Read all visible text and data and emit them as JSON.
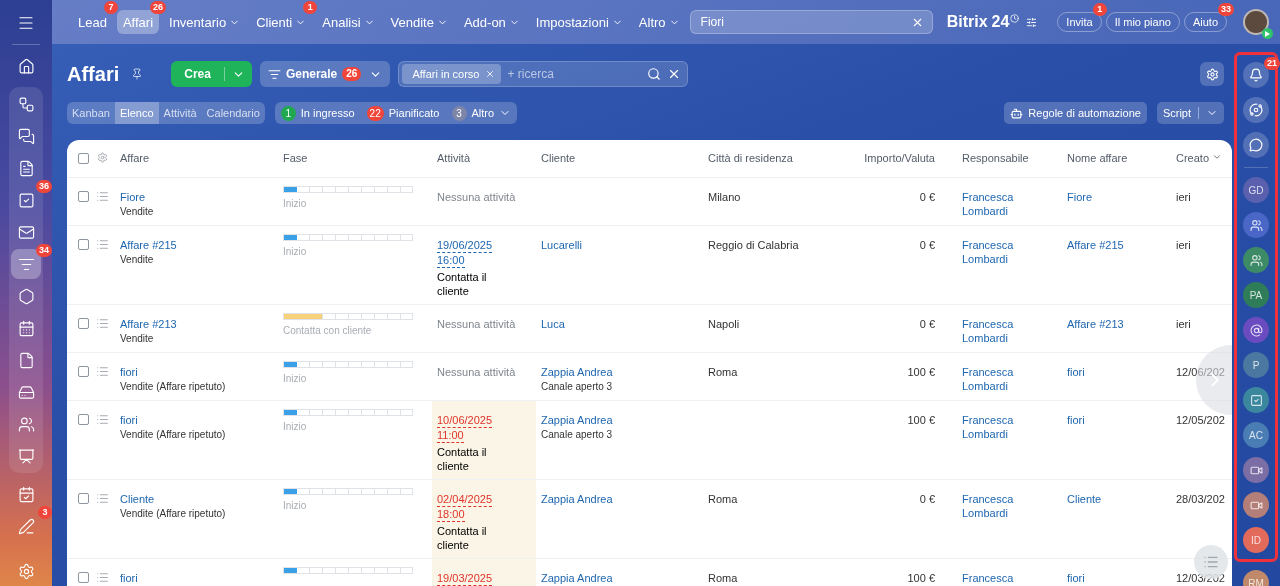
{
  "top_nav": {
    "items": [
      {
        "label": "Lead",
        "badge": "7",
        "dropdown": false,
        "selected": false
      },
      {
        "label": "Affari",
        "badge": "26",
        "dropdown": false,
        "selected": true
      },
      {
        "label": "Inventario",
        "dropdown": true,
        "selected": false
      },
      {
        "label": "Clienti",
        "badge": "1",
        "dropdown": true,
        "selected": false
      },
      {
        "label": "Analisi",
        "dropdown": true,
        "selected": false
      },
      {
        "label": "Vendite",
        "dropdown": true,
        "selected": false
      },
      {
        "label": "Add-on",
        "dropdown": true,
        "selected": false
      },
      {
        "label": "Impostazioni",
        "dropdown": true,
        "selected": false
      },
      {
        "label": "Altro",
        "dropdown": true,
        "selected": false
      }
    ],
    "search": {
      "value": "Fiori"
    },
    "logo": {
      "name": "Bitrix",
      "number": "24"
    },
    "buttons": [
      {
        "label": "Invita",
        "badge": "1"
      },
      {
        "label": "Il mio piano"
      },
      {
        "label": "Aiuto",
        "badge": "33"
      }
    ]
  },
  "left_sidebar": {
    "top": [
      {
        "selected": false
      }
    ],
    "pinned": [
      {
        "selected": false
      },
      {
        "selected": false
      },
      {
        "selected": false
      },
      {
        "badge": "36",
        "selected": false
      },
      {
        "selected": false
      },
      {
        "badge": "34",
        "selected": true
      },
      {
        "selected": false
      },
      {
        "selected": false
      },
      {
        "selected": false
      },
      {
        "selected": false
      },
      {
        "selected": false
      },
      {
        "selected": false
      }
    ],
    "bottom": [
      {
        "selected": false
      },
      {
        "badge": "3",
        "selected": false
      }
    ]
  },
  "page": {
    "title": "Affari",
    "create_button": "Crea",
    "filter": {
      "label": "Generale",
      "badge": "26"
    },
    "search": {
      "tag": "Affari in corso",
      "placeholder": "+ ricerca"
    },
    "view_tabs": [
      {
        "label": "Kanban",
        "selected": false
      },
      {
        "label": "Elenco",
        "selected": true
      },
      {
        "label": "Attività",
        "selected": false
      },
      {
        "label": "Calendario",
        "selected": false
      }
    ],
    "counters": [
      {
        "count": "1",
        "label": "In ingresso",
        "color": "#1fa84f",
        "dropdown": false
      },
      {
        "count": "22",
        "label": "Pianificato",
        "color": "#f0453a",
        "dropdown": false
      },
      {
        "count": "3",
        "label": "Altro",
        "color": "#7d86a8",
        "dropdown": true
      }
    ],
    "automation_button": "Regole di automazione",
    "script_button": "Script"
  },
  "table": {
    "all_checked": false,
    "columns": [
      {
        "label": "Affare",
        "sorted": false
      },
      {
        "label": "Fase",
        "sorted": false
      },
      {
        "label": "Attività",
        "sorted": false
      },
      {
        "label": "Cliente",
        "sorted": false
      },
      {
        "label": "Città di residenza",
        "sorted": false
      },
      {
        "label": "Importo/Valuta",
        "sorted": false
      },
      {
        "label": "Responsabile",
        "sorted": false
      },
      {
        "label": "Nome affare",
        "sorted": false
      },
      {
        "label": "Creato",
        "sorted": true
      }
    ],
    "rows": [
      {
        "checked": false,
        "deal": "Fiore",
        "pipeline": "Vendite",
        "stage": {
          "label": "Inizio",
          "level": 0.1,
          "color": "#3aa0e8"
        },
        "activity": {
          "kind": "none",
          "text": "Nessuna attività"
        },
        "city": "Milano",
        "amount": "0 €",
        "manager": "Francesca Lombardi",
        "deal_name": "Fiore",
        "created": "ieri"
      },
      {
        "checked": false,
        "deal": "Affare #215",
        "pipeline": "Vendite",
        "stage": {
          "label": "Inizio",
          "level": 0.1,
          "color": "#3aa0e8"
        },
        "activity": {
          "kind": "scheduled",
          "date": "19/06/2025",
          "time": "16:00",
          "task": "Contatta il cliente",
          "overdue": false
        },
        "client": {
          "name": "Lucarelli"
        },
        "city": "Reggio di Calabria",
        "amount": "0 €",
        "manager": "Francesca Lombardi",
        "deal_name": "Affare #215",
        "created": "ieri"
      },
      {
        "checked": false,
        "deal": "Affare #213",
        "pipeline": "Vendite",
        "stage": {
          "label": "Contatta con cliente",
          "level": 0.3,
          "color": "#f7d27a"
        },
        "activity": {
          "kind": "none",
          "text": "Nessuna attività"
        },
        "client": {
          "name": "Luca"
        },
        "city": "Napoli",
        "amount": "0 €",
        "manager": "Francesca Lombardi",
        "deal_name": "Affare #213",
        "created": "ieri"
      },
      {
        "checked": false,
        "deal": "fiori",
        "pipeline": "Vendite (Affare ripetuto)",
        "stage": {
          "label": "Inizio",
          "level": 0.1,
          "color": "#3aa0e8"
        },
        "activity": {
          "kind": "none",
          "text": "Nessuna attività"
        },
        "client": {
          "name": "Zappia Andrea",
          "sub": "Canale aperto 3"
        },
        "city": "Roma",
        "amount": "100 €",
        "manager": "Francesca Lombardi",
        "deal_name": "fiori",
        "created": "12/06/202"
      },
      {
        "checked": false,
        "deal": "fiori",
        "pipeline": "Vendite (Affare ripetuto)",
        "stage": {
          "label": "Inizio",
          "level": 0.1,
          "color": "#3aa0e8"
        },
        "activity": {
          "kind": "scheduled",
          "date": "10/06/2025",
          "time": "11:00",
          "task": "Contatta il cliente",
          "overdue": true
        },
        "client": {
          "name": "Zappia Andrea",
          "sub": "Canale aperto 3"
        },
        "amount": "100 €",
        "manager": "Francesca Lombardi",
        "deal_name": "fiori",
        "created": "12/05/202"
      },
      {
        "checked": false,
        "deal": "Cliente",
        "pipeline": "Vendite (Affare ripetuto)",
        "stage": {
          "label": "Inizio",
          "level": 0.1,
          "color": "#3aa0e8"
        },
        "activity": {
          "kind": "scheduled",
          "date": "02/04/2025",
          "time": "18:00",
          "task": "Contatta il cliente",
          "overdue": true
        },
        "client": {
          "name": "Zappia Andrea"
        },
        "city": "Roma",
        "amount": "0 €",
        "manager": "Francesca Lombardi",
        "deal_name": "Cliente",
        "created": "28/03/202"
      },
      {
        "checked": false,
        "deal": "fiori",
        "stage": {
          "level": 0.1,
          "color": "#3aa0e8"
        },
        "activity": {
          "kind": "scheduled",
          "date": "19/03/2025",
          "overdue": true
        },
        "client": {
          "name": "Zappia Andrea"
        },
        "city": "Roma",
        "amount": "100 €",
        "manager": "Francesca",
        "deal_name": "fiori",
        "created": "12/03/202"
      }
    ]
  },
  "right_panel": {
    "highlight_frame": {
      "items": [
        {
          "kind": "bell",
          "badge": "21"
        },
        {
          "kind": "copilot"
        },
        {
          "kind": "chat"
        },
        {
          "kind": "divider"
        },
        {
          "kind": "initials",
          "text": "GD",
          "color": "#5a5fae"
        },
        {
          "kind": "group",
          "color": "#4a67c8"
        },
        {
          "kind": "group",
          "color": "#3c8a66"
        },
        {
          "kind": "initials",
          "text": "PA",
          "color": "#2e7d58"
        },
        {
          "kind": "at",
          "color": "#6a4cc0"
        },
        {
          "kind": "initials",
          "text": "P",
          "color": "#4a78a0"
        },
        {
          "kind": "task",
          "color": "#3a879e"
        },
        {
          "kind": "initials",
          "text": "AC",
          "color": "#4a7db3"
        },
        {
          "kind": "video",
          "color": "#7a6ea5"
        },
        {
          "kind": "video",
          "color": "#b47f78"
        },
        {
          "kind": "initials",
          "text": "ID",
          "color": "#e26a5a"
        }
      ]
    },
    "items": [
      {
        "kind": "initials",
        "text": "RM",
        "color": "#c08a6a"
      }
    ]
  }
}
